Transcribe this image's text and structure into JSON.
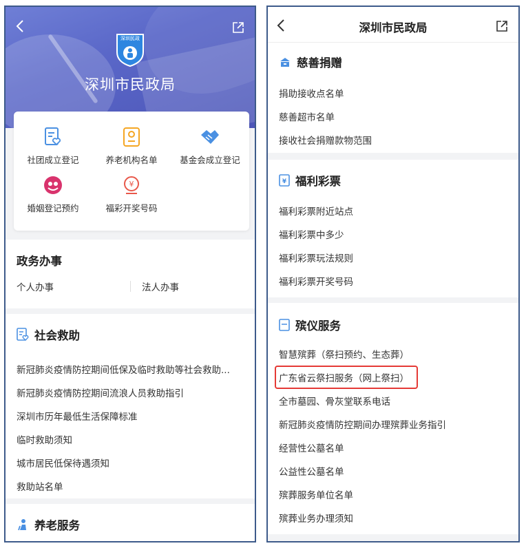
{
  "left": {
    "header": {
      "title": "深圳市民政局",
      "logo_text": "深圳民政"
    },
    "shortcuts": [
      {
        "label": "社团成立登记",
        "icon": "form-heart-icon"
      },
      {
        "label": "养老机构名单",
        "icon": "id-card-icon"
      },
      {
        "label": "基金会成立登记",
        "icon": "handshake-icon"
      },
      {
        "label": "婚姻登记预约",
        "icon": "marriage-icon"
      },
      {
        "label": "福彩开奖号码",
        "icon": "lottery-icon"
      }
    ],
    "gov_affairs": {
      "title": "政务办事",
      "tabs": [
        "个人办事",
        "法人办事"
      ]
    },
    "social_aid": {
      "title": "社会救助",
      "items": [
        "新冠肺炎疫情防控期间低保及临时救助等社会救助...",
        "新冠肺炎疫情防控期间流浪人员救助指引",
        "深圳市历年最低生活保障标准",
        "临时救助须知",
        "城市居民低保待遇须知",
        "救助站名单"
      ]
    },
    "elderly": {
      "title": "养老服务"
    }
  },
  "right": {
    "header": {
      "title": "深圳市民政局"
    },
    "charity": {
      "title": "慈善捐赠",
      "items": [
        "捐助接收点名单",
        "慈善超市名单",
        "接收社会捐赠款物范围"
      ]
    },
    "lottery": {
      "title": "福利彩票",
      "items": [
        "福利彩票附近站点",
        "福利彩票中多少",
        "福利彩票玩法规则",
        "福利彩票开奖号码"
      ]
    },
    "funeral": {
      "title": "殡仪服务",
      "items": [
        "智慧殡葬（祭扫预约、生态葬）",
        "广东省云祭扫服务（网上祭扫）",
        "全市墓园、骨灰堂联系电话",
        "新冠肺炎疫情防控期间办理殡葬业务指引",
        "经营性公墓名单",
        "公益性公墓名单",
        "殡葬服务单位名单",
        "殡葬业务办理须知"
      ]
    }
  },
  "colors": {
    "accent": "#4a90e2",
    "hero": "#5a67c8",
    "highlight": "#e53935"
  }
}
